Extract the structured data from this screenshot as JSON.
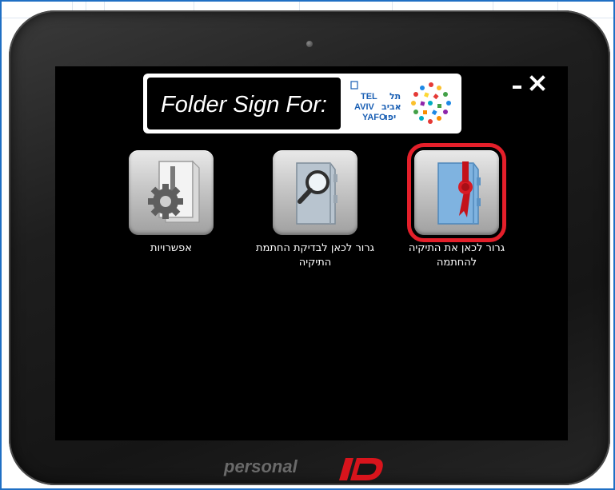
{
  "header": {
    "title": "Folder Sign For:",
    "logo": {
      "name": "tel-aviv-yafo-logo",
      "lines_latin": [
        "TEL",
        "AVIV",
        "YAFO"
      ],
      "lines_hebrew": [
        "תל",
        "אביב",
        "יפו"
      ]
    }
  },
  "window": {
    "minimize_icon": "minimize-icon",
    "close_icon": "close-icon"
  },
  "tiles": [
    {
      "name": "options",
      "icon": "gear-document-icon",
      "label": "אפשרויות"
    },
    {
      "name": "verify-folder-signature",
      "icon": "magnifier-folder-icon",
      "label": "גרור לכאן לבדיקת החתמת התיקיה"
    },
    {
      "name": "sign-folder",
      "icon": "sealed-folder-icon",
      "label": "גרור לכאן את התיקיה להחתמה",
      "selected": true
    }
  ],
  "footer": {
    "brand_text": "personal",
    "brand_mark": "iD"
  },
  "colors": {
    "frame_border": "#1f6fc4",
    "selection": "#e41f2a",
    "brand_red": "#d8141c",
    "screen": "#000000"
  }
}
